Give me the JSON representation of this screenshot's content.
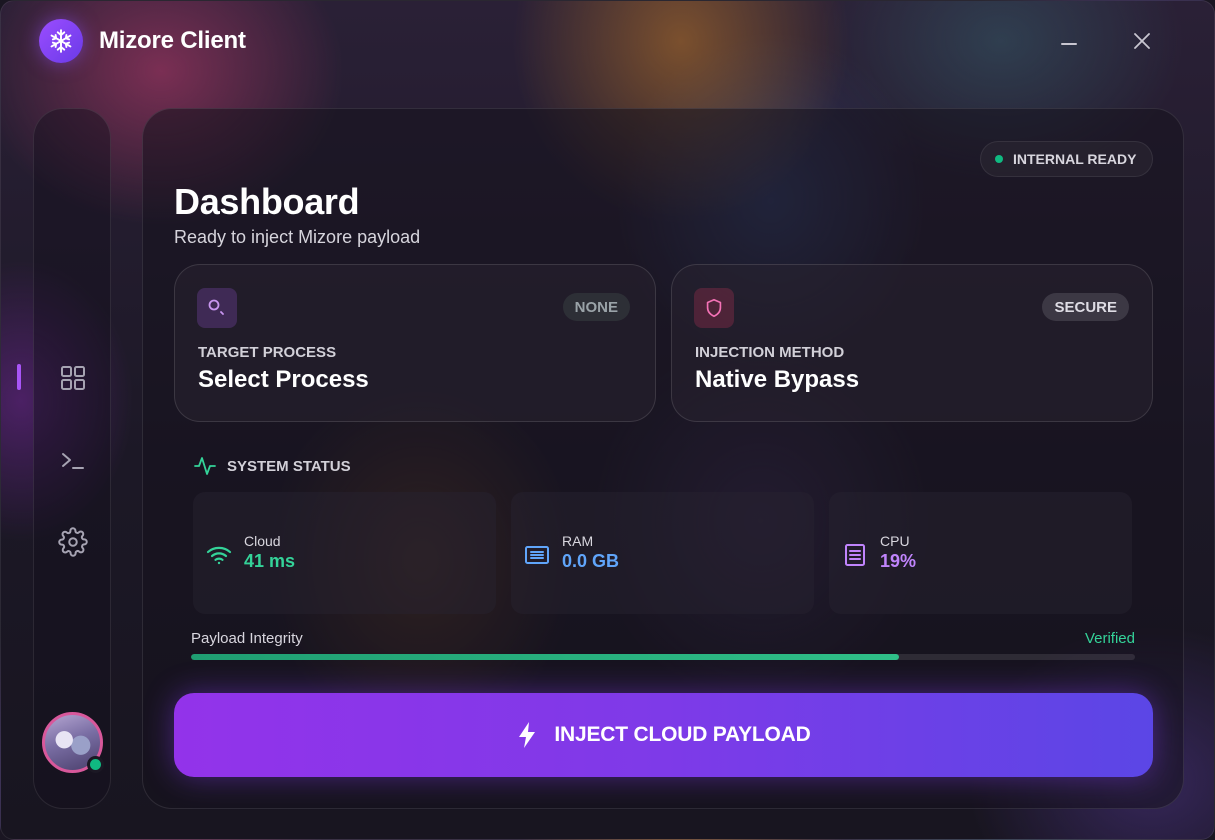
{
  "app": {
    "title": "Mizore Client"
  },
  "window_controls": {
    "minimize": "minimize",
    "close": "close"
  },
  "sidebar": {
    "items": [
      {
        "id": "dashboard",
        "icon": "grid-icon",
        "active": true
      },
      {
        "id": "console",
        "icon": "terminal-icon",
        "active": false
      },
      {
        "id": "settings",
        "icon": "gear-icon",
        "active": false
      }
    ],
    "user": {
      "icon": "avatar",
      "online": true
    }
  },
  "main": {
    "status_badge": "INTERNAL READY",
    "title": "Dashboard",
    "subtitle": "Ready to inject Mizore payload",
    "cards": {
      "target": {
        "label": "TARGET PROCESS",
        "value": "Select Process",
        "badge": "NONE",
        "icon": "search-icon"
      },
      "method": {
        "label": "INJECTION METHOD",
        "value": "Native Bypass",
        "badge": "SECURE",
        "icon": "shield-icon"
      }
    },
    "system_status": {
      "title": "SYSTEM STATUS",
      "metrics": [
        {
          "label": "Cloud",
          "value": "41 ms",
          "icon": "wifi-icon",
          "color": "#34d399"
        },
        {
          "label": "RAM",
          "value": "0.0 GB",
          "icon": "memory-icon",
          "color": "#60a5fa"
        },
        {
          "label": "CPU",
          "value": "19%",
          "icon": "cpu-icon",
          "color": "#c084fc"
        }
      ]
    },
    "integrity": {
      "label": "Payload Integrity",
      "status": "Verified",
      "progress": 0.75
    },
    "inject_button": {
      "label": "INJECT CLOUD PAYLOAD",
      "icon": "bolt-icon"
    }
  },
  "colors": {
    "accent": "#a855f7",
    "success": "#10b981",
    "button_start": "#9333ea",
    "button_end": "#5b46e6"
  }
}
